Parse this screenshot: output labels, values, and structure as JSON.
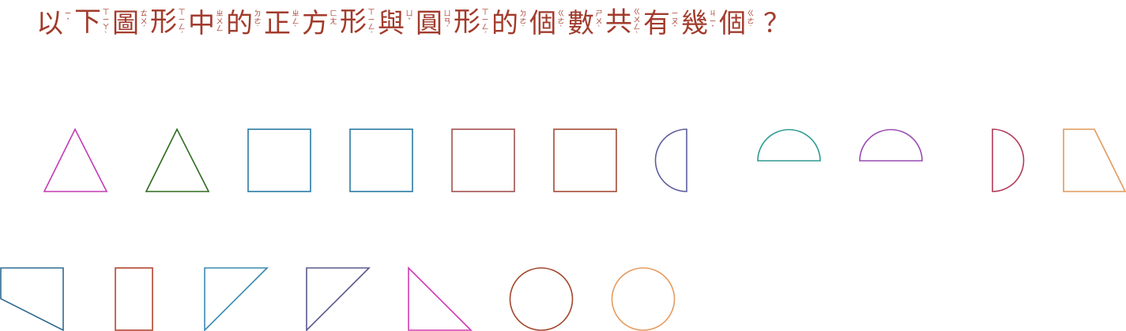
{
  "question": {
    "chars": [
      {
        "c": "以",
        "z": "ㄧˇ"
      },
      {
        "c": "下",
        "z": "ㄒㄧㄚˋ"
      },
      {
        "c": "圖",
        "z": "ㄊㄨˊ"
      },
      {
        "c": "形",
        "z": "ㄒㄧㄥˊ"
      },
      {
        "c": "中",
        "z": "ㄓㄨㄥ"
      },
      {
        "c": "的",
        "z": "ㄉㄜ˙"
      },
      {
        "c": "正",
        "z": "ㄓㄥˋ"
      },
      {
        "c": "方",
        "z": "ㄈㄤ"
      },
      {
        "c": "形",
        "z": "ㄒㄧㄥˊ"
      },
      {
        "c": "與",
        "z": "ㄩˇ"
      },
      {
        "c": "圓",
        "z": "ㄩㄢˊ"
      },
      {
        "c": "形",
        "z": "ㄒㄧㄥˊ"
      },
      {
        "c": "的",
        "z": "ㄉㄜ˙"
      },
      {
        "c": "個",
        "z": "ㄍㄜˋ"
      },
      {
        "c": "數",
        "z": "ㄕㄨˋ"
      },
      {
        "c": "共",
        "z": "ㄍㄨㄥˋ"
      },
      {
        "c": "有",
        "z": "ㄧㄡˇ"
      },
      {
        "c": "幾",
        "z": "ㄐㄧˇ"
      },
      {
        "c": "個",
        "z": "ㄍㄜ˙"
      }
    ],
    "end_mark": "？"
  },
  "colors": {
    "text": "#a23b2c",
    "magenta": "#c43bb4",
    "green": "#2e6b1f",
    "teal_blue": "#2a7aa2",
    "rose_brown": "#a1504e",
    "brown": "#a24b35",
    "slate_purple": "#5e5e9e",
    "teal": "#2f9a93",
    "purple": "#9a4bb4",
    "crimson": "#b23b5a",
    "orange": "#e09a5c",
    "steel_blue": "#2f6a92",
    "red_brown": "#b2452e",
    "sky_blue": "#3a8ab2",
    "slate_blue": "#5a5a8e",
    "pink": "#d23bb4",
    "sienna": "#a4462e",
    "peach": "#e69b5e"
  },
  "shapes": [
    {
      "kind": "triangle",
      "color": "magenta"
    },
    {
      "kind": "triangle",
      "color": "green"
    },
    {
      "kind": "square",
      "color": "teal_blue"
    },
    {
      "kind": "square",
      "color": "teal_blue"
    },
    {
      "kind": "square",
      "color": "rose_brown"
    },
    {
      "kind": "square",
      "color": "brown"
    },
    {
      "kind": "semicircle-left",
      "color": "slate_purple"
    },
    {
      "kind": "semicircle-top",
      "color": "teal"
    },
    {
      "kind": "semicircle-top",
      "color": "purple"
    },
    {
      "kind": "semicircle-right",
      "color": "crimson"
    },
    {
      "kind": "trapezoid",
      "color": "orange"
    },
    {
      "kind": "quadrilateral",
      "color": "steel_blue"
    },
    {
      "kind": "rectangle",
      "color": "red_brown"
    },
    {
      "kind": "right-triangle",
      "color": "sky_blue"
    },
    {
      "kind": "right-triangle",
      "color": "slate_blue"
    },
    {
      "kind": "right-triangle",
      "color": "pink"
    },
    {
      "kind": "circle",
      "color": "sienna"
    },
    {
      "kind": "circle",
      "color": "peach"
    }
  ]
}
